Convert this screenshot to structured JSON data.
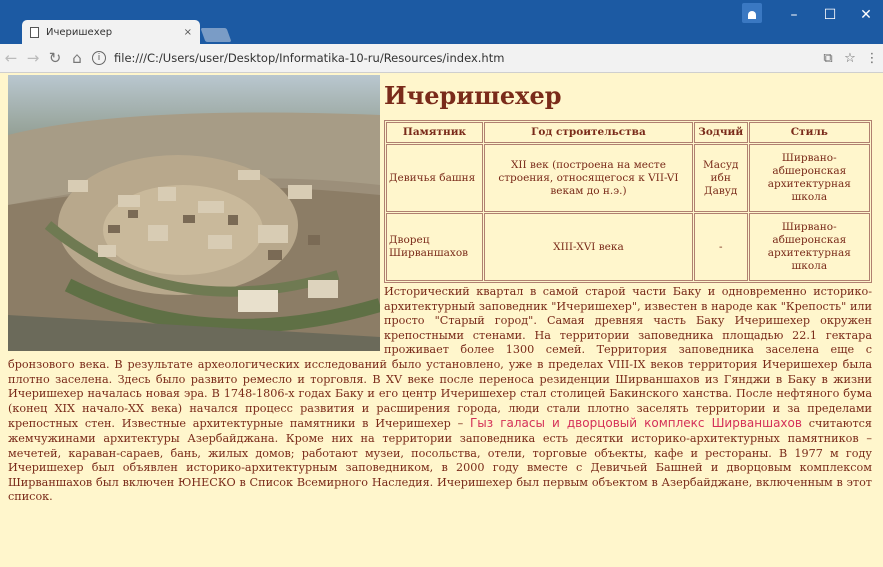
{
  "browser": {
    "tab_title": "Ичеришехер",
    "tab_close": "×",
    "new_tab": "",
    "url": "file:///C:/Users/user/Desktop/Informatika-10-ru/Resources/index.htm"
  },
  "page": {
    "title": "Ичеришехер",
    "table": {
      "headers": [
        "Памятник",
        "Год строительства",
        "Зодчий",
        "Стиль"
      ],
      "rows": [
        [
          "Девичья башня",
          "XII век (построена на месте строения, относящегося к VII-VI векам до н.э.)",
          "Масуд ибн Давуд",
          "Ширвано-абшеронская архитектурная школа"
        ],
        [
          "Дворец Ширваншахов",
          "XIII-XVI века",
          "-",
          "Ширвано-абшеронская архитектурная школа"
        ]
      ]
    },
    "paragraph_before": "Исторический квартал в самой старой части Баку и одновременно историко-архитектурный заповедник \"Ичеришехер\", известен в народе как \"Крепость\" или просто \"Старый город\". Самая древняя часть Баку Ичеришехер окружен крепостными стенами. На территории заповедника площадью 22.1 гектара проживает более 1300 семей. Территория заповедника заселена еще с бронзового века. В результате археологических исследований было установлено, уже в пределах VIII-IX веков территория Ичеришехер была плотно заселена. Здесь было развито ремесло и торговля. В XV веке после переноса резиденции Ширваншахов из Гянджи в Баку в жизни Ичеришехер началась новая эра. В 1748-1806-х годах Баку и его центр Ичеришехер стал столицей Бакинского ханства. После нефтяного бума (конец XIX начало-XX века) начался процесс развития и расширения города, люди стали плотно заселять территории и за пределами крепостных стен. Известные архитектурные памятники в Ичеришехер – ",
    "highlight": "Гыз галасы и дворцовый комплекс Ширваншахов",
    "paragraph_after": " считаются жемчужинами архитектуры Азербайджана. Кроме них на территории заповедника есть десятки историко-архитектурных памятников – мечетей, караван-сараев, бань, жилых домов; работают музеи, посольства, отели, торговые объекты, кафе и рестораны. В 1977 м году Ичеришехер был объявлен историко-архитектурным заповедником, в 2000 году вместе с Девичьей Башней и дворцовым комплексом Ширваншахов был включен ЮНЕСКО в Список Всемирного Наследия. Ичеришехер был первым объектом в Азербайджане, включенным в этот список."
  },
  "colors": {
    "titlebar": "#1c5aa3",
    "page_bg": "#fff6cc",
    "text": "#7a2b1a",
    "highlight": "#d43058"
  }
}
